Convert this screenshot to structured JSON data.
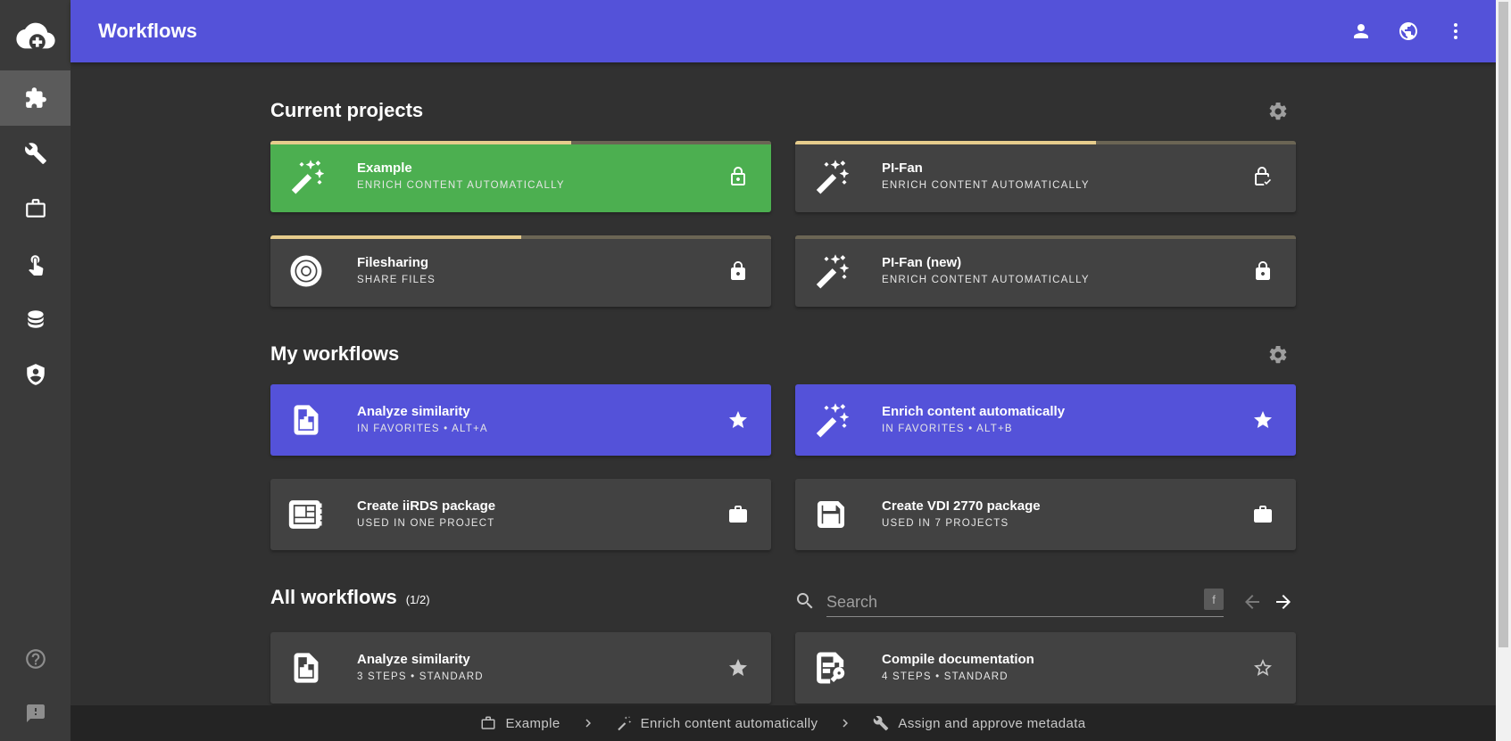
{
  "sidebar": {
    "items": [
      {
        "icon": "cloud-upload-icon"
      },
      {
        "icon": "puzzle-icon",
        "active": true
      },
      {
        "icon": "wrench-icon"
      },
      {
        "icon": "briefcase-icon"
      },
      {
        "icon": "pointer-hand-icon"
      },
      {
        "icon": "database-icon"
      },
      {
        "icon": "shield-account-icon"
      },
      {
        "icon": "help-circle-icon"
      },
      {
        "icon": "feedback-icon"
      }
    ]
  },
  "header": {
    "title": "Workflows",
    "icons": [
      "account-icon",
      "globe-icon",
      "more-vertical-icon"
    ]
  },
  "current_projects": {
    "title": "Current projects",
    "cards": [
      {
        "name": "Example",
        "subtitle": "ENRICH CONTENT AUTOMATICALLY",
        "progress": 0.6,
        "icon": "magic-wand-icon",
        "action_icon": "lock-open-icon",
        "color": "#4caf50"
      },
      {
        "name": "PI-Fan",
        "subtitle": "ENRICH CONTENT AUTOMATICALLY",
        "progress": 0.6,
        "icon": "magic-wand-icon",
        "action_icon": "lock-check-icon",
        "color": "#424242"
      },
      {
        "name": "Filesharing",
        "subtitle": "SHARE FILES",
        "progress": 0.5,
        "icon": "target-icon",
        "action_icon": "lock-icon",
        "color": "#424242"
      },
      {
        "name": "PI-Fan (new)",
        "subtitle": "ENRICH CONTENT AUTOMATICALLY",
        "progress": 0,
        "icon": "magic-wand-icon",
        "action_icon": "lock-icon",
        "color": "#424242"
      }
    ]
  },
  "my_workflows": {
    "title": "My workflows",
    "cards": [
      {
        "name": "Analyze similarity",
        "subtitle": "IN FAVORITES • ALT+A",
        "icon": "chart-file-icon",
        "action_icon": "star-icon",
        "color": "#5452d9"
      },
      {
        "name": "Enrich content automatically",
        "subtitle": "IN FAVORITES • ALT+B",
        "icon": "magic-wand-icon",
        "action_icon": "star-icon",
        "color": "#5452d9"
      },
      {
        "name": "Create iiRDS package",
        "subtitle": "USED IN ONE PROJECT",
        "icon": "package-layout-icon",
        "action_icon": "briefcase-icon",
        "color": "#424242"
      },
      {
        "name": "Create VDI 2770 package",
        "subtitle": "USED IN 7 PROJECTS",
        "icon": "floppy-icon",
        "action_icon": "briefcase-icon",
        "color": "#424242"
      }
    ]
  },
  "all_workflows": {
    "title": "All workflows",
    "count": "(1/2)",
    "search_placeholder": "Search",
    "search_shortcut": "f",
    "cards": [
      {
        "name": "Analyze similarity",
        "subtitle": "3 STEPS • STANDARD",
        "icon": "chart-file-icon",
        "action_icon": "star-icon"
      },
      {
        "name": "Compile documentation",
        "subtitle": "4 STEPS • STANDARD",
        "icon": "document-search-icon",
        "action_icon": "star-outline-icon"
      }
    ]
  },
  "breadcrumb": [
    {
      "label": "Example",
      "icon": "briefcase-outline-icon"
    },
    {
      "label": "Enrich content automatically",
      "icon": "magic-wand-icon"
    },
    {
      "label": "Assign and approve metadata",
      "icon": "wrench-icon"
    }
  ]
}
